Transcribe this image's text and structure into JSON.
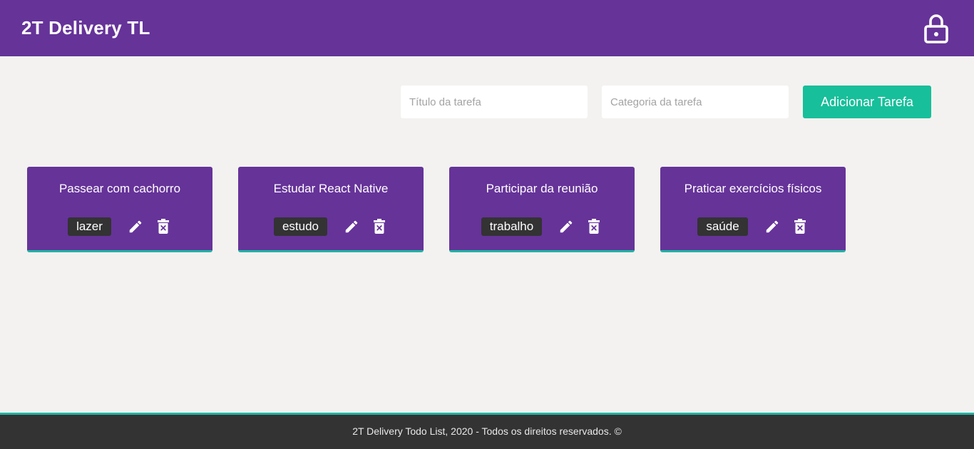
{
  "header": {
    "brand": "2T Delivery TL",
    "logout_icon": "lock-icon"
  },
  "form": {
    "title_placeholder": "Título da tarefa",
    "category_placeholder": "Categoria da tarefa",
    "add_button_label": "Adicionar Tarefa"
  },
  "tasks": [
    {
      "title": "Passear com cachorro",
      "category": "lazer"
    },
    {
      "title": "Estudar React Native",
      "category": "estudo"
    },
    {
      "title": "Participar da reunião",
      "category": "trabalho"
    },
    {
      "title": "Praticar exercícios físicos",
      "category": "saúde"
    }
  ],
  "icons": {
    "edit": "pencil-icon",
    "delete": "trash-icon"
  },
  "footer": {
    "text": "2T Delivery Todo List, 2020 - Todos os direitos reservados. ©"
  },
  "colors": {
    "primary": "#663399",
    "accent": "#17bf9a",
    "card_border": "#1fb5a3",
    "footer_bg": "#333333",
    "page_bg": "#f3f2f0"
  }
}
